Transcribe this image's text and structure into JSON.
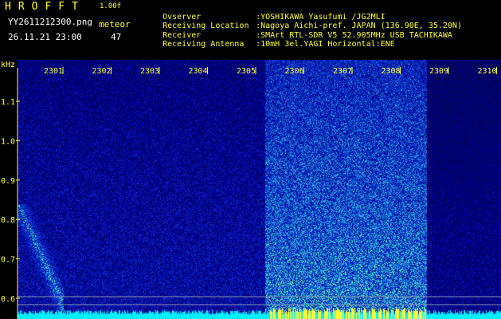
{
  "header": {
    "app_title": "HROFFT",
    "version": "1.00f",
    "filename": "YY2611212300.png",
    "datetime": "26.11.21 23:00",
    "meteor_label": "meteor",
    "meteor_count": "47"
  },
  "station_info": [
    {
      "label": "Ovserver",
      "value": ":YOSHIKAWA Yasufumi /JG2MLI"
    },
    {
      "label": "Receiving Location",
      "value": ":Nagoya Aichi-pref. JAPAN (136.90E, 35.20N)"
    },
    {
      "label": "Receiver",
      "value": ":SMArt RTL-SDR V5 52.905MHz USB TACHIKAWA"
    },
    {
      "label": "Receiving Antenna",
      "value": ":10mH 3el.YAGI Horizontal:ENE"
    }
  ],
  "spectrogram": {
    "y_unit": "kHz",
    "y_ticks": [
      "1.1",
      "1.0",
      "0.9",
      "0.8",
      "0.7",
      "0.6"
    ],
    "time_ticks": [
      "2301",
      "2302",
      "2303",
      "2304",
      "2305",
      "2306",
      "2307",
      "2308",
      "2309",
      "2310"
    ],
    "colors": {
      "axis": "#ffff33",
      "background": "#000020",
      "noise": "#1a2fd0",
      "signal": "#00ffff"
    }
  }
}
